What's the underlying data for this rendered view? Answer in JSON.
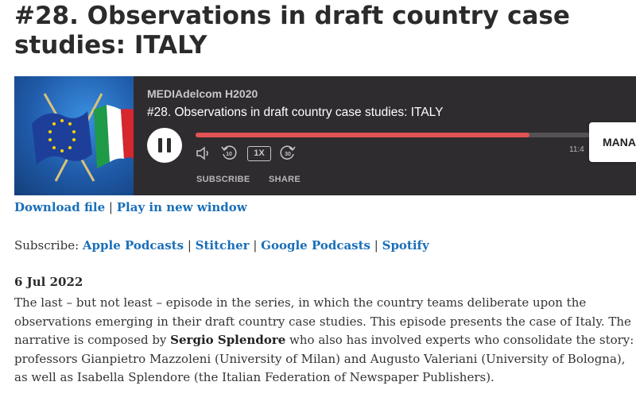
{
  "page": {
    "title": "#28. Observations in draft country case studies: ITALY"
  },
  "player": {
    "show_name": "MEDIAdelcom H2020",
    "episode_title": "#28. Observations in draft country case studies: ITALY",
    "progress_fraction": 0.75,
    "speed": "1X",
    "time": "11:4",
    "subscribe_label": "SUBSCRIBE",
    "share_label": "SHARE",
    "manage_label": "MANA",
    "icons": [
      "pause-icon",
      "volume-icon",
      "rewind-10-icon",
      "forward-30-icon",
      "eu-flag-icon",
      "italy-flag-icon"
    ],
    "colors": {
      "background": "#2f2c2f",
      "progress": "#e25353"
    }
  },
  "links": {
    "download": "Download file",
    "separator": "|",
    "play_new_window": "Play in new window"
  },
  "subscribe": {
    "label": "Subscribe:",
    "services": [
      "Apple Podcasts",
      "Stitcher",
      "Google Podcasts",
      "Spotify"
    ]
  },
  "post": {
    "date": "6 Jul 2022",
    "text_1": "The last – but  not least – episode in the series, in which the country teams deliberate upon the observations emerging in their draft country case studies. This episode presents the case of Italy. The narrative is composed by ",
    "author": "Sergio Splendore",
    "text_2": " who also has involved experts who consolidate the story: professors Gianpietro Mazzoleni (University of Milan) and Augusto Valeriani (University of Bologna), as well as Isabella Splendore (the Italian Federation of Newspaper Publishers)."
  }
}
